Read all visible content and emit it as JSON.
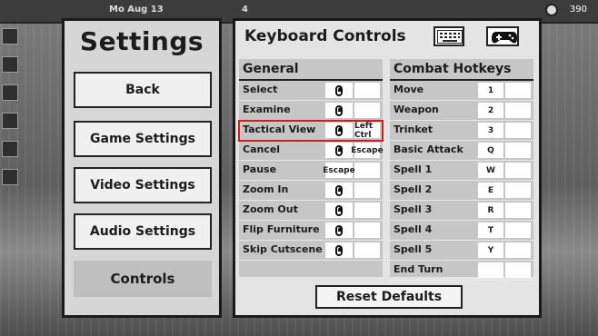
{
  "top_bar": {
    "date": "Mo Aug 13",
    "home_count": "4",
    "gold": "390"
  },
  "settings_menu": {
    "title": "Settings",
    "items": [
      {
        "label": "Back"
      },
      {
        "label": "Game Settings"
      },
      {
        "label": "Video Settings"
      },
      {
        "label": "Audio Settings"
      },
      {
        "label": "Controls",
        "selected": true
      }
    ]
  },
  "keyboard_controls": {
    "title": "Keyboard Controls",
    "device_icons": [
      "keyboard-icon",
      "gamepad-icon"
    ],
    "general": {
      "header": "General",
      "rows": [
        {
          "action": "Select",
          "key1": "left-click-mouse",
          "key2": ""
        },
        {
          "action": "Examine",
          "key1": "right-click-mouse",
          "key2": ""
        },
        {
          "action": "Tactical View",
          "key1": "right-click-mouse",
          "key2": "Left Ctrl",
          "highlighted": true
        },
        {
          "action": "Cancel",
          "key1": "right-click-mouse",
          "key2": "Escape"
        },
        {
          "action": "Pause",
          "key1": "Escape",
          "key2": ""
        },
        {
          "action": "Zoom In",
          "key1": "scroll-mouse",
          "key2": ""
        },
        {
          "action": "Zoom Out",
          "key1": "scroll-mouse",
          "key2": ""
        },
        {
          "action": "Flip Furniture",
          "key1": "right-click-mouse",
          "key2": ""
        },
        {
          "action": "Skip Cutscene",
          "key1": "right-click-mouse",
          "key2": ""
        }
      ]
    },
    "combat": {
      "header": "Combat Hotkeys",
      "rows": [
        {
          "action": "Move",
          "key1": "1",
          "key2": ""
        },
        {
          "action": "Weapon",
          "key1": "2",
          "key2": ""
        },
        {
          "action": "Trinket",
          "key1": "3",
          "key2": ""
        },
        {
          "action": "Basic Attack",
          "key1": "Q",
          "key2": ""
        },
        {
          "action": "Spell 1",
          "key1": "W",
          "key2": ""
        },
        {
          "action": "Spell 2",
          "key1": "E",
          "key2": ""
        },
        {
          "action": "Spell 3",
          "key1": "R",
          "key2": ""
        },
        {
          "action": "Spell 4",
          "key1": "T",
          "key2": ""
        },
        {
          "action": "Spell 5",
          "key1": "Y",
          "key2": ""
        },
        {
          "action": "End Turn",
          "key1": "",
          "key2": ""
        }
      ]
    },
    "reset_label": "Reset Defaults"
  },
  "colors": {
    "highlight": "#d41c1c",
    "panel": "#e4e4e4",
    "column": "#c6c6c6"
  }
}
